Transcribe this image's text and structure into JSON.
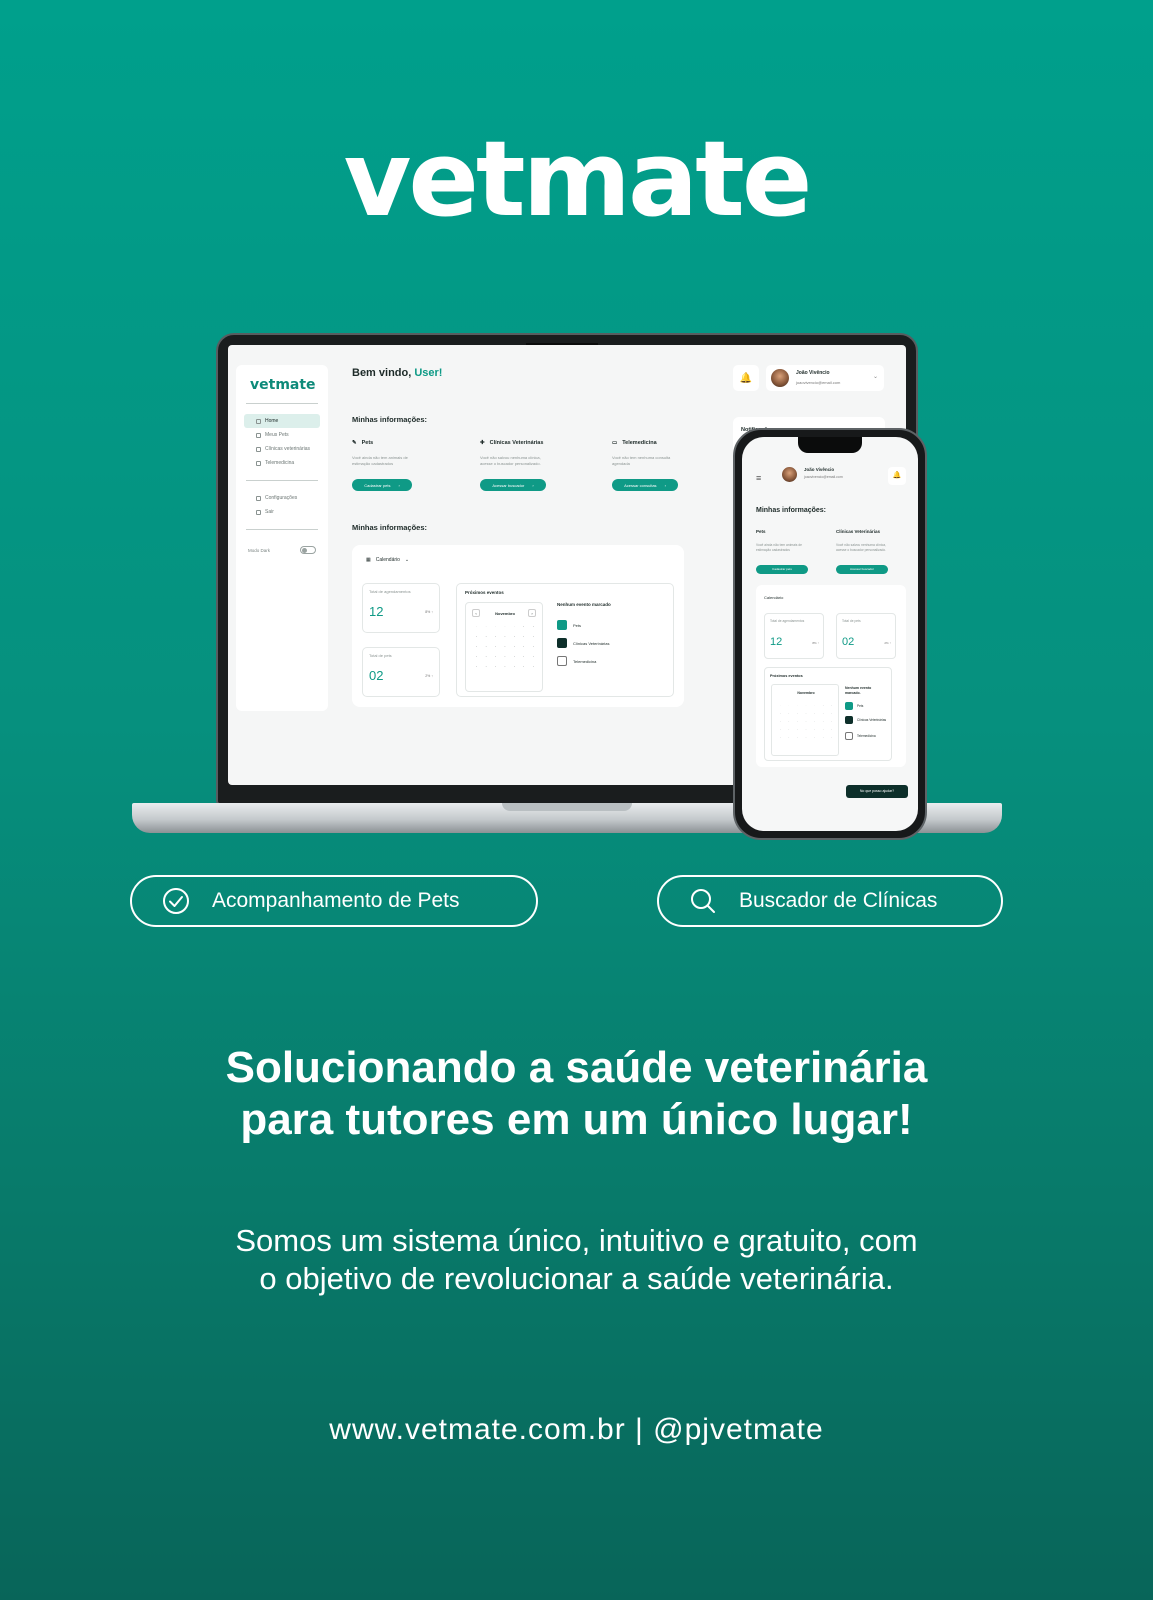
{
  "brand": {
    "logo": "vetmate"
  },
  "laptop_app": {
    "sidebar": {
      "logo": "vetmate",
      "items": [
        "Home",
        "Meus Pets",
        "Clínicas veterinárias",
        "Telemedicina"
      ],
      "bottom_items": [
        "Configurações",
        "Sair"
      ],
      "mode_label": "Modo Dark"
    },
    "welcome_prefix": "Bem vindo, ",
    "welcome_user": "User!",
    "user": {
      "name": "João Vivêncio",
      "email": "joaovivencio@email.com"
    },
    "section_title": "Minhas informações:",
    "section_title_2": "Minhas informações:",
    "cards": [
      {
        "title": "Pets",
        "desc": "Você ainda não tem animais de estimação cadastrados",
        "button": "Cadastrar pets"
      },
      {
        "title": "Clínicas Veterinárias",
        "desc": "Você não salvou nenhuma clínica, acesse o buscador personalizado.",
        "button": "Acessar buscador"
      },
      {
        "title": "Telemedicina",
        "desc": "Você não tem nenhuma consulta agendada",
        "button": "Acessar consultas"
      }
    ],
    "calendar_label": "Calendário",
    "stats": [
      {
        "label": "Total de agendamentos",
        "value": "12",
        "badge": "8% ↑"
      },
      {
        "label": "Total de pets",
        "value": "02",
        "badge": "2% ↑"
      }
    ],
    "events_title": "Próximos eventos",
    "month": "Novembro",
    "no_event": "Nenhum evento marcado",
    "event_types": [
      "Pets",
      "Clínicas Veterinárias",
      "Telemedicina"
    ],
    "notifications_title": "Notificações"
  },
  "phone_app": {
    "user": {
      "name": "João Vivêncio",
      "email": "joaovivencio@email.com"
    },
    "section_title": "Minhas informações:",
    "cards": [
      {
        "title": "Pets",
        "desc": "Você ainda não tem animais de estimação cadastrados",
        "button": "Cadastrar pets"
      },
      {
        "title": "Clínicas Veterinárias",
        "desc": "Você não salvou nenhuma clínica, acesse o buscador personalizado.",
        "button": "Acessar buscador"
      }
    ],
    "calendar_label": "Calendário",
    "stats": [
      {
        "label": "Total de agendamentos",
        "value": "12",
        "badge": "8% ↑"
      },
      {
        "label": "Total de pets",
        "value": "02",
        "badge": "2% ↑"
      }
    ],
    "events_title": "Próximos eventos",
    "month": "Novembro",
    "no_event": "Nenhum evento marcado.",
    "event_types": [
      "Pets",
      "Clínicas Veterinárias",
      "Telemedicina"
    ],
    "help_button": "No que posso ajudar?"
  },
  "features": [
    {
      "label": "Acompanhamento de Pets",
      "icon": "check-circle-icon"
    },
    {
      "label": "Buscador de Clínicas",
      "icon": "search-icon"
    }
  ],
  "headline_line1": "Solucionando a saúde veterinária",
  "headline_line2": "para tutores em um único lugar!",
  "subtext_line1": "Somos um sistema único, intuitivo e gratuito, com",
  "subtext_line2": "o objetivo de revolucionar a saúde veterinária.",
  "contact": "www.vetmate.com.br | @pjvetmate",
  "colors": {
    "brand": "#0f9a86",
    "background_top": "#00a08c",
    "background_bottom": "#086559"
  }
}
